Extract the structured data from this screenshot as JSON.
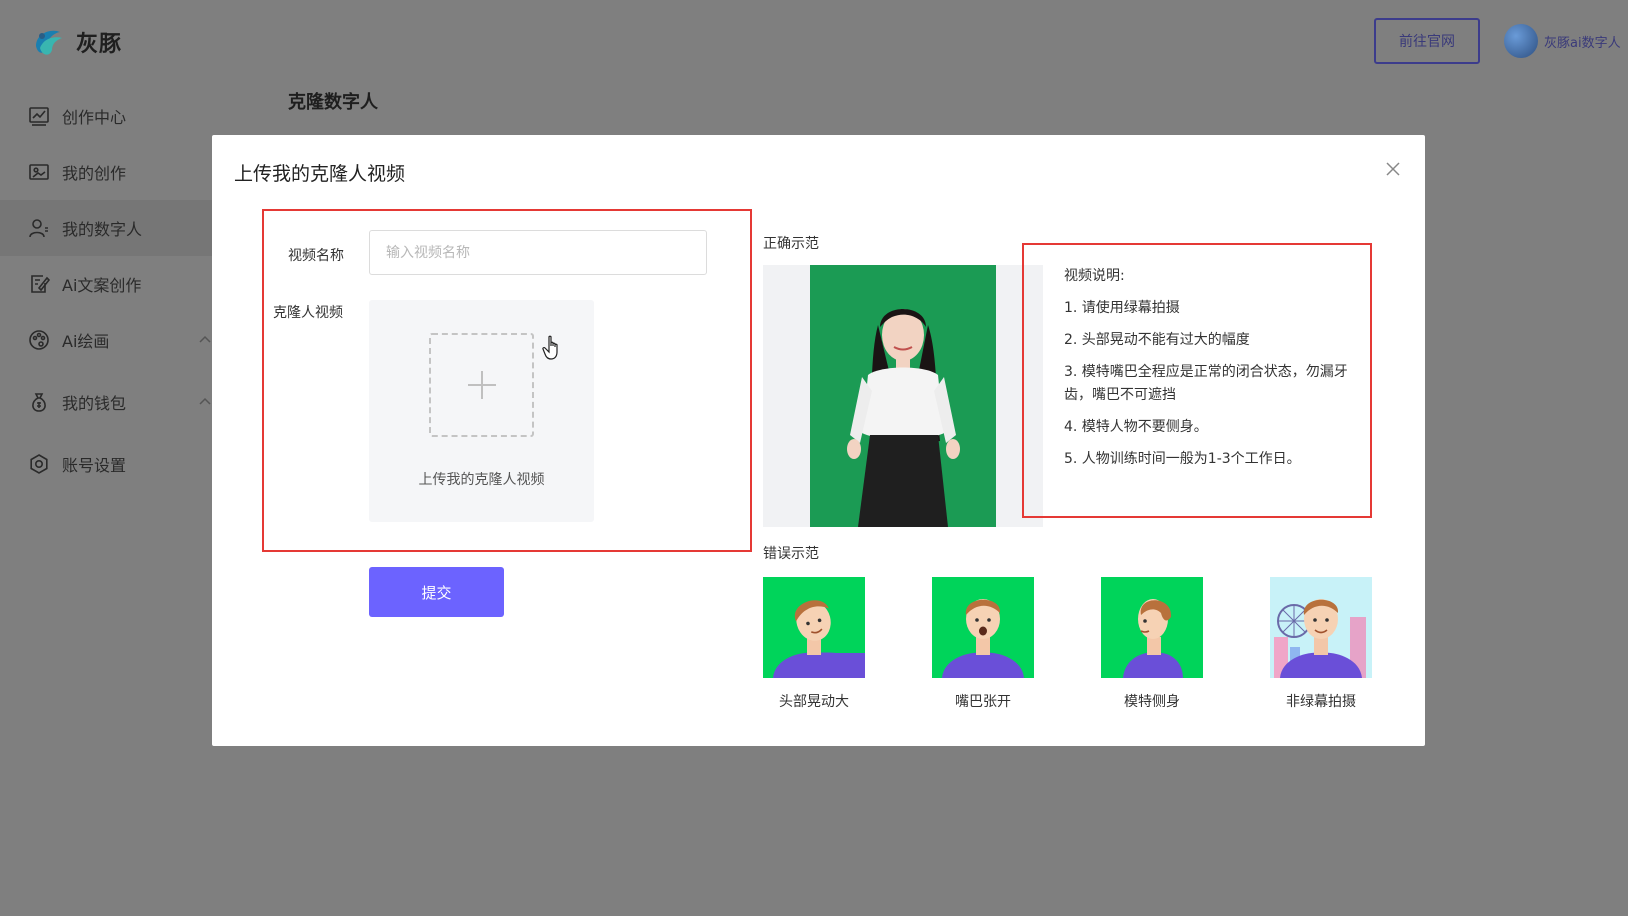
{
  "app": {
    "logo_text": "灰豚"
  },
  "header": {
    "official_site_button": "前往官网",
    "user_name": "灰豚ai数字人"
  },
  "sidebar": {
    "items": [
      {
        "label": "创作中心",
        "icon": "chart-line-icon"
      },
      {
        "label": "我的创作",
        "icon": "image-card-icon"
      },
      {
        "label": "我的数字人",
        "icon": "user-icon",
        "active": true
      },
      {
        "label": "Ai文案创作",
        "icon": "edit-doc-icon"
      },
      {
        "label": "Ai绘画",
        "icon": "palette-icon",
        "expandable": true
      },
      {
        "label": "我的钱包",
        "icon": "money-bag-icon",
        "expandable": true
      },
      {
        "label": "账号设置",
        "icon": "gear-icon"
      }
    ]
  },
  "page": {
    "heading": "克隆数字人"
  },
  "modal": {
    "title": "上传我的克隆人视频",
    "form": {
      "name_label": "视频名称",
      "name_placeholder": "输入视频名称",
      "name_value": "",
      "video_label": "克隆人视频",
      "upload_text": "上传我的克隆人视频",
      "submit_label": "提交"
    },
    "correct_example": {
      "title": "正确示范"
    },
    "notes": {
      "title": "视频说明:",
      "items": [
        "1. 请使用绿幕拍摄",
        "2. 头部晃动不能有过大的幅度",
        "3. 模特嘴巴全程应是正常的闭合状态，勿漏牙齿，嘴巴不可遮挡",
        "4. 模特人物不要侧身。",
        "5. 人物训练时间一般为1-3个工作日。"
      ]
    },
    "wrong_example": {
      "title": "错误示范",
      "items": [
        {
          "label": "头部晃动大"
        },
        {
          "label": "嘴巴张开"
        },
        {
          "label": "模特侧身"
        },
        {
          "label": "非绿幕拍摄"
        }
      ]
    }
  },
  "colors": {
    "overlay": "#7f7f7f",
    "primary_button": "#6c63ff",
    "highlight_border": "#e53935",
    "green_screen": "#1b9b54",
    "example_green": "#00d45a",
    "shirt_purple": "#6a4fd8"
  }
}
